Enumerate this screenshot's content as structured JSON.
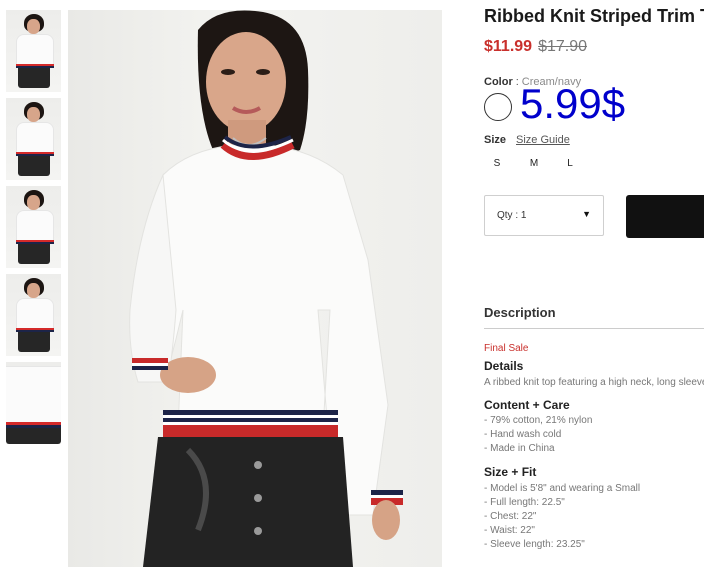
{
  "product": {
    "title": "Ribbed Knit Striped Trim Top",
    "sale_price": "$11.99",
    "original_price": "$17.90",
    "overlay_price": "5.99$"
  },
  "color": {
    "label": "Color",
    "separator": ":",
    "value": "Cream/navy",
    "swatch_color": "#ffffff"
  },
  "size": {
    "label": "Size",
    "guide_link": "Size Guide",
    "options": [
      "S",
      "M",
      "L"
    ]
  },
  "quantity": {
    "label": "Qty : 1",
    "caret": "▼"
  },
  "description": {
    "heading": "Description",
    "final_sale": "Final Sale",
    "details_heading": "Details",
    "details_text": "A ribbed knit top featuring a high neck, long sleeves",
    "care_heading": "Content + Care",
    "care_items": [
      "- 79% cotton, 21% nylon",
      "- Hand wash cold",
      "- Made in China"
    ],
    "fit_heading": "Size + Fit",
    "fit_items": [
      "- Model is 5'8\" and wearing a Small",
      "- Full length: 22.5\"",
      "- Chest: 22\"",
      "- Waist: 22\"",
      "- Sleeve length: 23.25\""
    ]
  },
  "colors": {
    "sale_red": "#c9302c",
    "overlay_blue": "#0000cc",
    "button_black": "#111111"
  }
}
